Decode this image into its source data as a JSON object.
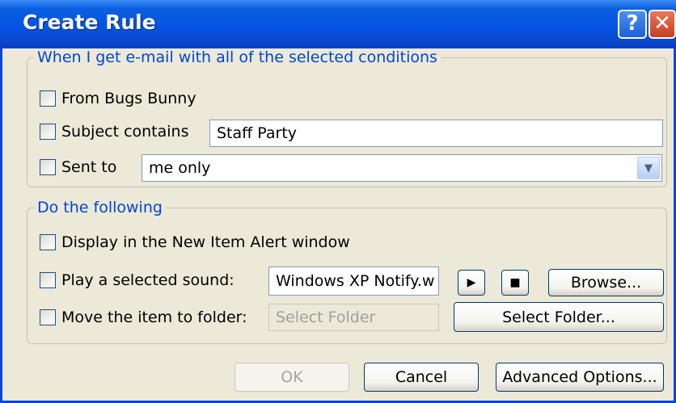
{
  "window": {
    "title": "Create Rule",
    "help_label": "?",
    "close_label": "✕"
  },
  "conditions": {
    "legend": "When I get e-mail with all of the selected conditions",
    "from_label": "From Bugs Bunny",
    "subject_label": "Subject contains",
    "subject_value": "Staff Party",
    "sentto_label": "Sent to",
    "sentto_value": "me only",
    "sentto_checked": false,
    "from_checked": false,
    "subject_checked": false
  },
  "actions": {
    "legend": "Do the following",
    "alert_label": "Display in the New Item Alert window",
    "sound_label": "Play a selected sound:",
    "sound_value": "Windows XP Notify.w",
    "play_icon": "▶",
    "stop_icon": "■",
    "browse_label": "Browse...",
    "move_label": "Move the item to folder:",
    "folder_placeholder": "Select Folder",
    "select_folder_label": "Select Folder..."
  },
  "footer": {
    "ok_label": "OK",
    "cancel_label": "Cancel",
    "advanced_label": "Advanced Options..."
  },
  "icons": {
    "dropdown": "chevron-down-icon",
    "play": "play-icon",
    "stop": "stop-icon",
    "help": "help-icon",
    "close": "close-icon"
  },
  "colors": {
    "titlebar": "#0554e3",
    "legend": "#0046d5",
    "dialog_bg": "#ece9d8"
  }
}
